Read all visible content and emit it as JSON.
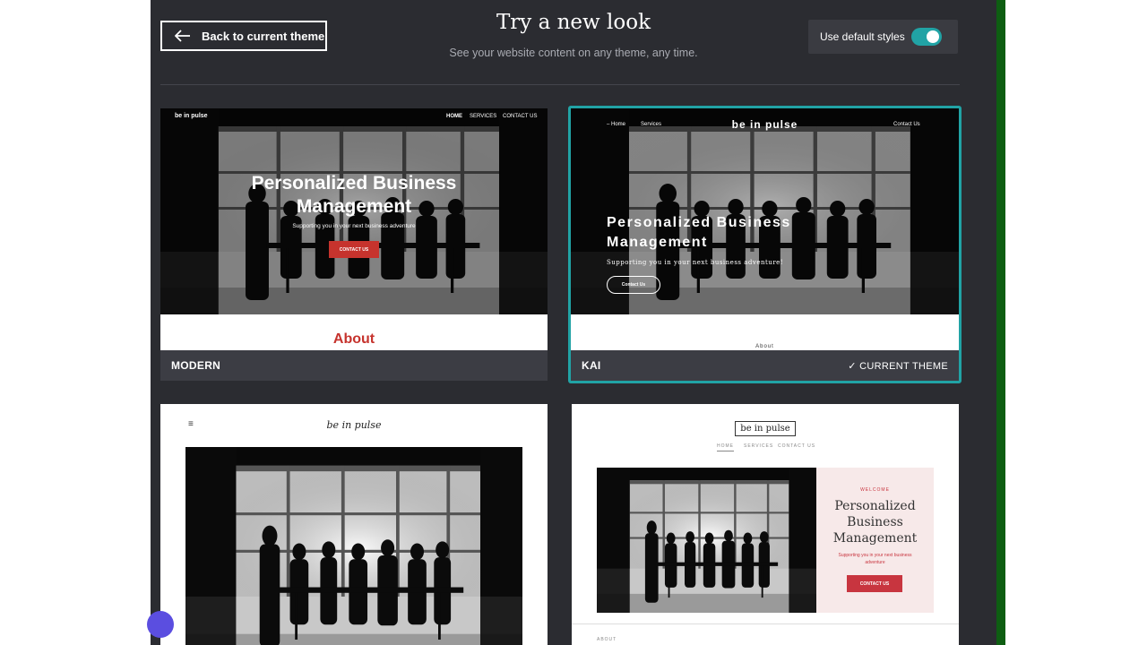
{
  "header": {
    "back_label": "Back to current theme",
    "title": "Try a new look",
    "subtitle": "See your website content on any theme, any time.",
    "toggle_label": "Use default styles",
    "toggle_on": true
  },
  "colors": {
    "accent": "#21a3a5",
    "panel": "#2b2c31",
    "brand_red": "#c6332d",
    "pink_red": "#c8353f"
  },
  "themes": [
    {
      "name": "MODERN",
      "brand": "be in pulse",
      "nav": [
        "HOME",
        "SERVICES",
        "CONTACT US"
      ],
      "hero_title": "Personalized Business Management",
      "hero_subtitle": "Supporting you in your next business adventure",
      "cta": "CONTACT US",
      "section": "About"
    },
    {
      "name": "KAI",
      "current": "✓ CURRENT THEME",
      "brand": "be in pulse",
      "nav": [
        "Home",
        "Services",
        "Contact Us"
      ],
      "hero_title": "Personalized Business Management",
      "hero_subtitle": "Supporting you in your next business adventure!",
      "cta": "Contact Us",
      "section": "About"
    },
    {
      "brand": "be in pulse"
    },
    {
      "brand": "be in pulse",
      "nav": [
        "HOME",
        "SERVICES",
        "CONTACT US"
      ],
      "welcome": "WELCOME",
      "hero_title": "Personalized Business Management",
      "hero_subtitle": "Supporting you in your next business adventure",
      "cta": "CONTACT US",
      "section": "ABOUT"
    }
  ]
}
